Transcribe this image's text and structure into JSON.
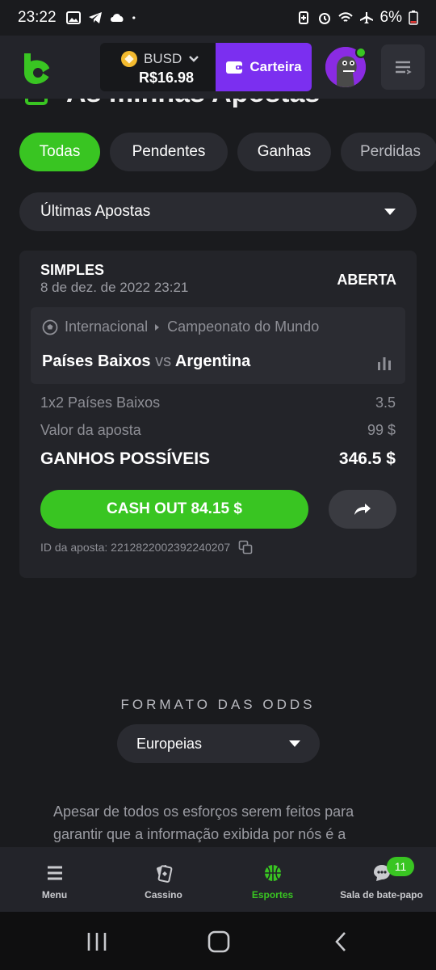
{
  "status_bar": {
    "time": "23:22",
    "battery": "6%"
  },
  "header": {
    "currency": "BUSD",
    "balance": "R$16.98",
    "wallet_label": "Carteira"
  },
  "page": {
    "title": "As minhas Apostas"
  },
  "filters": {
    "tabs": [
      "Todas",
      "Pendentes",
      "Ganhas",
      "Perdidas"
    ],
    "dropdown": "Últimas Apostas"
  },
  "bet": {
    "type": "SIMPLES",
    "date": "8 de dez. de 2022 23:21",
    "status": "ABERTA",
    "category": "Internacional",
    "competition": "Campeonato do Mundo",
    "home": "Países Baixos",
    "vs": "vs",
    "away": "Argentina",
    "selection_label": "1x2 Países Baixos",
    "selection_odds": "3.5",
    "stake_label": "Valor da aposta",
    "stake_value": "99 $",
    "winnings_label": "GANHOS POSSÍVEIS",
    "winnings_value": "346.5 $",
    "cashout_label": "CASH OUT 84.15 $",
    "bet_id": "ID da aposta: 2212822002392240207"
  },
  "odds_format": {
    "title": "FORMATO DAS ODDS",
    "selected": "Europeias"
  },
  "disclaimer": "Apesar de todos os esforços serem feitos para garantir que a informação exibida por nós é a",
  "bottom_nav": {
    "menu": "Menu",
    "casino": "Cassino",
    "sports": "Esportes",
    "chat": "Sala de bate-papo",
    "chat_badge": "11"
  },
  "colors": {
    "accent_green": "#39c522",
    "wallet_purple": "#7b2ff0",
    "background": "#1a1b1e"
  }
}
